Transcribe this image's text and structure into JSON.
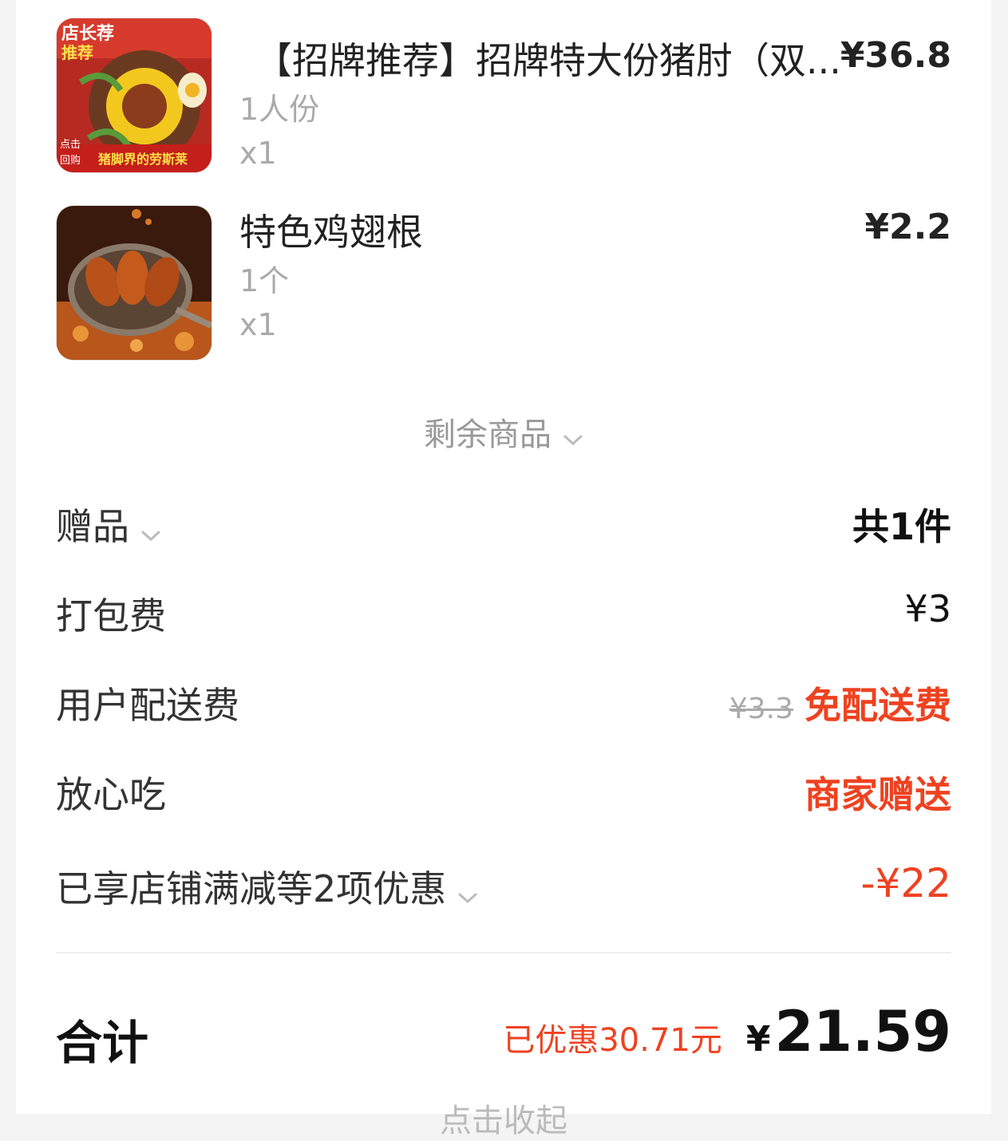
{
  "items": [
    {
      "name": "【招牌推荐】招牌特大份猪肘（双...",
      "spec": "1人份",
      "qty": "x1",
      "price": "¥36.8",
      "thumb_text": [
        "店长荐",
        "推荐",
        "点击",
        "回购",
        "猪脚界的劳斯莱"
      ],
      "thumb_icon": "pork-knuckle-photo"
    },
    {
      "name": "特色鸡翅根",
      "spec": "1个",
      "qty": "x1",
      "price": "¥2.2",
      "thumb_icon": "chicken-wings-photo"
    }
  ],
  "more_items": {
    "label": "剩余商品",
    "icon": "chevron-down-icon"
  },
  "fees": {
    "gift": {
      "label": "赠品",
      "value": "共1件"
    },
    "packing": {
      "label": "打包费",
      "value": "¥3"
    },
    "delivery": {
      "label": "用户配送费",
      "original": "¥3.3",
      "value": "免配送费"
    },
    "assurance": {
      "label": "放心吃",
      "value": "商家赠送"
    },
    "discount": {
      "label": "已享店铺满减等2项优惠",
      "value": "-¥22"
    }
  },
  "total": {
    "label": "合计",
    "saved": "已优惠30.71元",
    "currency": "¥",
    "amount": "21.59"
  },
  "collapse": {
    "label": "点击收起"
  },
  "colors": {
    "accent_red": "#ee4220",
    "muted": "#aaaaaa",
    "text": "#222222"
  }
}
